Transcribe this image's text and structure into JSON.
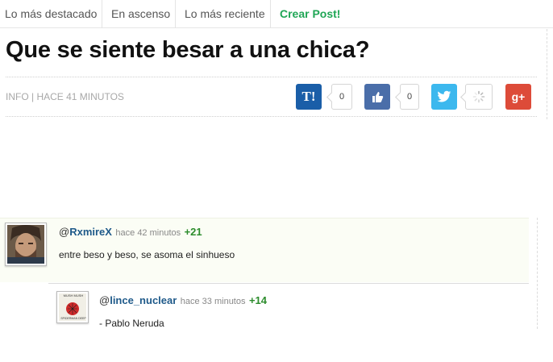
{
  "nav": {
    "items": [
      {
        "label": "Lo más destacado"
      },
      {
        "label": "En ascenso"
      },
      {
        "label": "Lo más reciente"
      },
      {
        "label": "Crear Post!"
      }
    ]
  },
  "post": {
    "title": "Que se siente besar a una chica?",
    "meta": "INFO | HACE 41 MINUTOS"
  },
  "share": {
    "taringa": {
      "icon": "taringa-icon",
      "label": "T!",
      "count": "0",
      "color": "#1a5ea8"
    },
    "like": {
      "icon": "thumbs-up-icon",
      "count": "0",
      "color": "#3b5998"
    },
    "twitter": {
      "icon": "twitter-bird-icon",
      "color": "#2fb5ec"
    },
    "spinner": {
      "icon": "loading-spinner-icon"
    },
    "gplus": {
      "icon": "google-plus-icon",
      "label": "g+",
      "color": "#dd4b39"
    }
  },
  "comments": [
    {
      "at": "@",
      "user": "RxmireX",
      "time": "hace 42 minutos",
      "score": "+21",
      "text": "entre beso y beso, se asoma el sinhueso"
    },
    {
      "at": "@",
      "user": "lince_nuclear",
      "time": "hace 33 minutos",
      "score": "+14",
      "text": "- Pablo Neruda",
      "avatar_text": [
        "MUSH MUSH",
        "SPIDERMAN DEEP"
      ]
    }
  ]
}
